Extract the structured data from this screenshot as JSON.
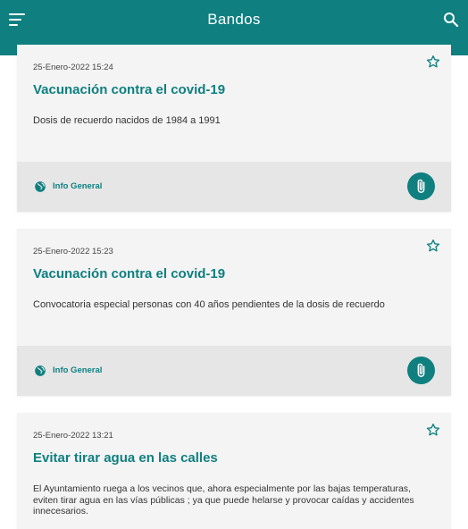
{
  "header": {
    "title": "Bandos",
    "menu_icon": "menu-icon",
    "search_icon": "search-icon"
  },
  "bandos": [
    {
      "date": "25-Enero-2022 15:24",
      "title": "Vacunación contra el covid-19",
      "body": "Dosis de recuerdo nacidos de 1984 a 1991",
      "category": "Info General",
      "favorite_icon": "star-outline-icon",
      "category_icon": "globe-icon",
      "attachment_icon": "paperclip-icon"
    },
    {
      "date": "25-Enero-2022 15:23",
      "title": "Vacunación contra el covid-19",
      "body": "Convocatoria especial personas con 40 años pendientes de la dosis de recuerdo",
      "category": "Info General",
      "favorite_icon": "star-outline-icon",
      "category_icon": "globe-icon",
      "attachment_icon": "paperclip-icon"
    },
    {
      "date": "25-Enero-2022 13:21",
      "title": "Evitar tirar agua en las calles",
      "body": "El Ayuntamiento ruega a los vecinos que, ahora especialmente por las bajas temperaturas, eviten tirar agua en las vías públicas ; ya que puede helarse y provocar caídas y accidentes innecesarios.",
      "favorite_icon": "star-outline-icon"
    }
  ],
  "colors": {
    "primary": "#0f7f80",
    "card_background": "#f4f4f4",
    "card_footer": "#e6e6e6"
  }
}
